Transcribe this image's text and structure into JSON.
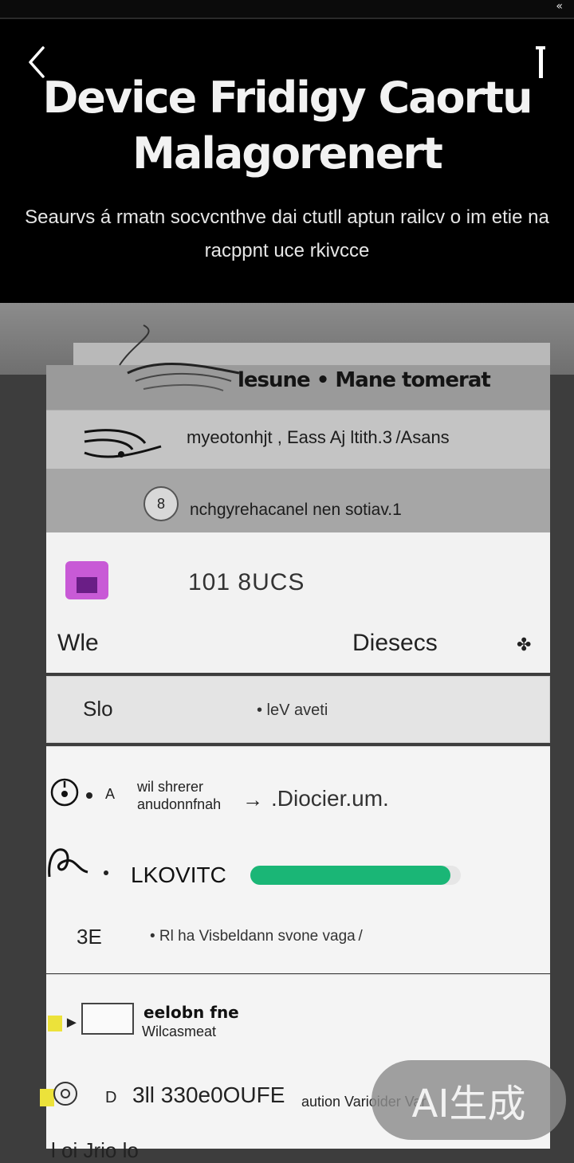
{
  "status_bar": {
    "glyph": "«"
  },
  "header": {
    "title": "Device Fridigy Caortu Malagorenert",
    "subtitle": "Seaurvs á rmatn socvcnthve dai ctutll aptun railcv o im etie na racppnt uce rkivcce"
  },
  "banner": {
    "title": "lesune • Mane tomerat"
  },
  "info_rows": [
    {
      "text": "myeotonhjt , Eass Aj ltith.3 /Asans"
    },
    {
      "badge": "8",
      "text": "nchgyrehacanel nen sotiav.1"
    }
  ],
  "card1": {
    "value": "101 8UCS",
    "left_label": "Wle",
    "right_label": "Diesecs",
    "sort_glyph": "✤"
  },
  "card2": {
    "left_label": "Slo",
    "mid_text": "• leV aveti"
  },
  "card3": {
    "row1_letter": "A",
    "row1_label": "wil shrerer\nanudonnfnah",
    "row1_arrow": "→",
    "row1_value": ".Diocier.um.",
    "row2_label": "LKOVITC",
    "row2_progress": 0.95,
    "row3_label": "3E",
    "row3_note": "• Rl ha Visbeldann svone vaga /"
  },
  "card4": {
    "row1_title": "eelobn fne",
    "row1_sub": "Wilcasmeat",
    "row2_d": "D",
    "row2_value": "3ll 330e0OUFE",
    "row2_note": "aution Varioider Var",
    "row3_text": "l oi Jrio lo"
  },
  "watermark": {
    "text": "AI生成"
  },
  "colors": {
    "progress": "#1ab676",
    "app_icon": "#c85ad6",
    "highlight": "#ece23a"
  }
}
